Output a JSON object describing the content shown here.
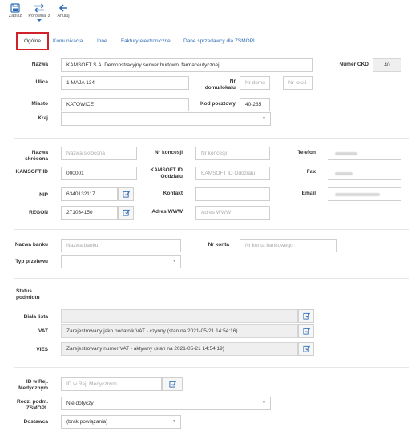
{
  "toolbar": {
    "save": "Zapisz",
    "compare": "Porównaj z",
    "cancel": "Anuluj"
  },
  "tabs": [
    "Ogólne",
    "Komunikacja",
    "Inne",
    "Faktury elektroniczne",
    "Dane sprzedawcy dla ZSMOPL"
  ],
  "section1": {
    "nazwa_label": "Nazwa",
    "nazwa_value": "KAMSOFT S.A. Demonstracyjny serwer hurtowni farmaceutycznej",
    "numer_ckd_label": "Numer CKD",
    "numer_ckd_value": "40",
    "ulica_label": "Ulica",
    "ulica_value": "1 MAJA 134",
    "nr_domu_label": "Nr domu/lokalu",
    "nr_domu_placeholder": "Nr domu",
    "nr_lokalu_placeholder": "Nr lokal",
    "miasto_label": "Miasto",
    "miasto_value": "KATOWICE",
    "kod_label": "Kod pocztowy",
    "kod_value": "40-235",
    "kraj_label": "Kraj",
    "kraj_value": ""
  },
  "section2": {
    "nazwa_skr_label": "Nazwa skrócona",
    "nazwa_skr_placeholder": "Nazwa skrócona",
    "nr_koncesji_label": "Nr koncesji",
    "nr_koncesji_placeholder": "Nr koncesji",
    "telefon_label": "Telefon",
    "kamsoft_id_label": "KAMSOFT ID",
    "kamsoft_id_value": "000001",
    "kamsoft_id_oddz_label": "KAMSOFT ID Oddziału",
    "kamsoft_id_oddz_placeholder": "KAMSOFT ID Oddziału",
    "fax_label": "Fax",
    "nip_label": "NIP",
    "nip_value": "6340132117",
    "kontakt_label": "Kontakt",
    "email_label": "Email",
    "regon_label": "REGON",
    "regon_value": "271034150",
    "www_label": "Adres WWW",
    "www_placeholder": "Adres WWW"
  },
  "section3": {
    "bank_label": "Nazwa banku",
    "bank_placeholder": "Nazwa banku",
    "konto_label": "Nr konta",
    "konto_placeholder": "Nr konta bankowego",
    "typ_label": "Typ przelewu",
    "typ_value": ""
  },
  "section4": {
    "status_label": "Status podmiotu",
    "biala_label": "Biała lista",
    "biala_value": "-",
    "vat_label": "VAT",
    "vat_value": "Zarejestrowany jako podatnik VAT - czynny (stan na 2021-05-21 14:54:16)",
    "vies_label": "VIES",
    "vies_value": "Zarejestrowany numer VAT - aktywny (stan na 2021-05-21 14:54:19)"
  },
  "section5": {
    "id_rej_label": "ID w Rej. Medycznym",
    "id_rej_placeholder": "ID w Rej. Medycznym",
    "rodz_label": "Rodz. podm. ZSMOPL",
    "rodz_value": "Nie dotyczy",
    "dostawca_label": "Dostawca",
    "dostawca_value": "(brak powiązania)"
  },
  "colors": {
    "accent": "#2f6db5",
    "active_tab_border": "#d0222a"
  }
}
